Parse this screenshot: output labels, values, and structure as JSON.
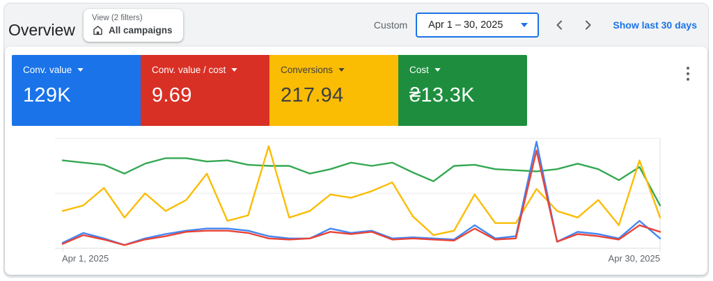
{
  "header": {
    "title": "Overview",
    "view_chip": {
      "caption": "View (2 filters)",
      "label": "All campaigns",
      "icon": "home-icon"
    },
    "date_range": {
      "mode_label": "Custom",
      "value": "Apr 1 – 30, 2025"
    },
    "show_last_link": "Show last 30 days"
  },
  "scorecards": [
    {
      "label": "Conv. value",
      "value": "129K",
      "bg": "#1a73e8",
      "fg": "#ffffff"
    },
    {
      "label": "Conv. value / cost",
      "value": "9.69",
      "bg": "#d93025",
      "fg": "#ffffff"
    },
    {
      "label": "Conversions",
      "value": "217.94",
      "bg": "#fbbc04",
      "fg": "#3c4043"
    },
    {
      "label": "Cost",
      "value": "₴13.3K",
      "bg": "#1e8e3e",
      "fg": "#ffffff"
    }
  ],
  "menu": {
    "kebab": "more-options"
  },
  "chart_data": {
    "type": "line",
    "x_days": 30,
    "x_start_label": "Apr 1, 2025",
    "x_end_label": "Apr 30, 2025",
    "ylim": [
      0,
      100
    ],
    "grid": "horizontal, 3 lines (bottom axis, middle, top), no y tick labels",
    "legend": "none — series colors match scorecards above",
    "series": [
      {
        "name": "Conv. value",
        "color": "#4285f4",
        "values": [
          5,
          14,
          9,
          3,
          9,
          13,
          16,
          18,
          18,
          16,
          11,
          9,
          9,
          18,
          14,
          16,
          9,
          10,
          9,
          8,
          21,
          9,
          11,
          97,
          6,
          15,
          13,
          9,
          25,
          9
        ]
      },
      {
        "name": "Conv. value / cost",
        "color": "#ea4335",
        "values": [
          4,
          12,
          8,
          3,
          8,
          11,
          15,
          16,
          16,
          14,
          9,
          8,
          9,
          15,
          13,
          15,
          8,
          9,
          8,
          7,
          18,
          8,
          9,
          89,
          6,
          13,
          11,
          8,
          21,
          15
        ]
      },
      {
        "name": "Conversions",
        "color": "#fbbc04",
        "values": [
          34,
          39,
          55,
          28,
          50,
          34,
          44,
          68,
          25,
          30,
          93,
          28,
          34,
          49,
          46,
          52,
          60,
          29,
          12,
          16,
          49,
          23,
          23,
          54,
          34,
          28,
          44,
          21,
          80,
          28
        ]
      },
      {
        "name": "Cost",
        "color": "#34a853",
        "values": [
          80,
          78,
          76,
          68,
          77,
          82,
          82,
          79,
          80,
          76,
          75,
          75,
          68,
          72,
          78,
          75,
          78,
          69,
          61,
          75,
          76,
          72,
          71,
          70,
          72,
          77,
          72,
          62,
          74,
          39
        ]
      }
    ]
  }
}
